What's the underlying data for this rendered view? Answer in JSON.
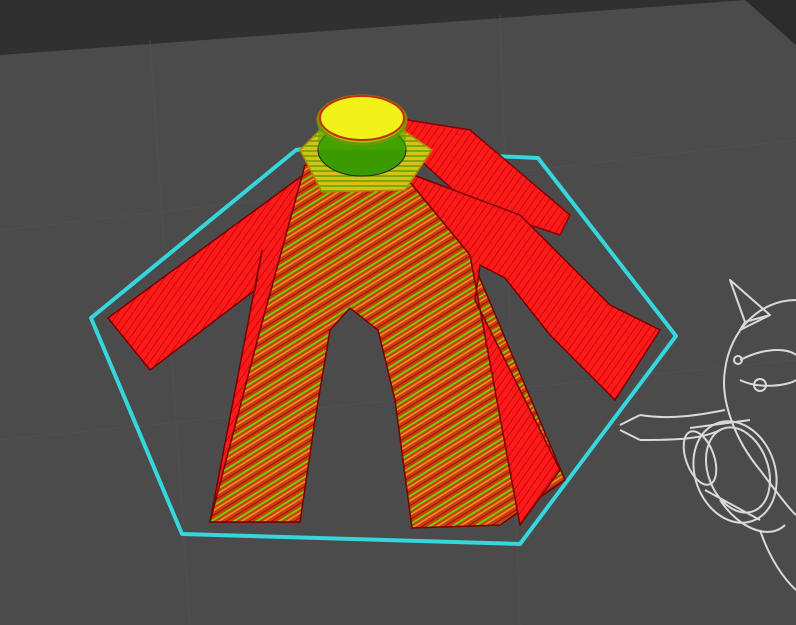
{
  "viewport": {
    "view": "3d-slicer-layer-preview",
    "colors": {
      "background": "#2b2b2b",
      "build_plate": "#4b4b4b",
      "plate_dark": "#3a3a3a",
      "plate_line": "#555555",
      "skirt": "#35d7dd",
      "outer_wall": "#ff1a1a",
      "infill_green": "#5fd000",
      "infill_orange": "#d58a18",
      "top_surface": "#f2f21a",
      "wireframe": "#d9d9d9"
    },
    "objects": [
      {
        "name": "sliced-model",
        "parts": [
          "nut-hex",
          "nut-cap",
          "leg-left",
          "leg-center",
          "leg-right",
          "leg-back-right"
        ]
      },
      {
        "name": "unsliced-model-wireframe",
        "parts": [
          "spike",
          "ring",
          "body"
        ]
      }
    ]
  }
}
